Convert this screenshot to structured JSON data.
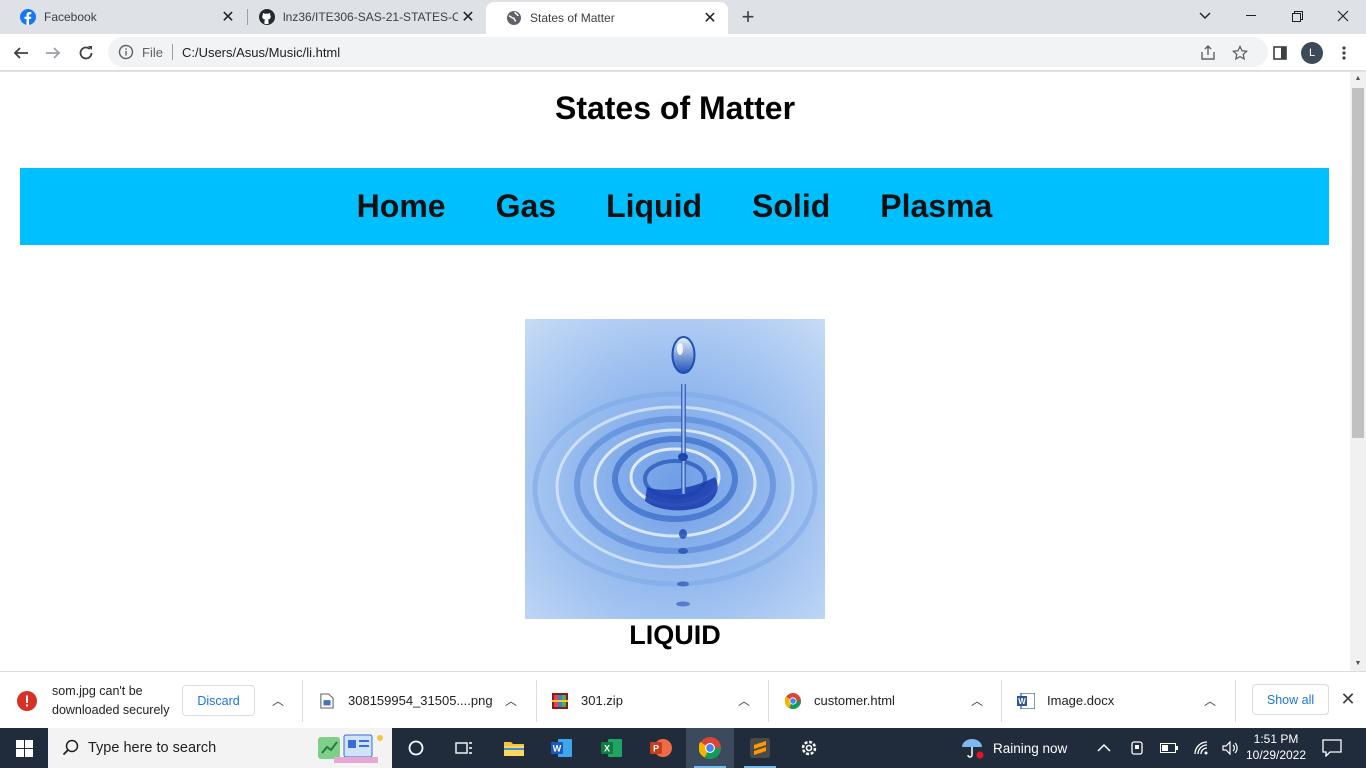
{
  "browser": {
    "tabs": [
      {
        "title": "Facebook",
        "favicon": "facebook-icon",
        "active": false
      },
      {
        "title": "lnz36/ITE306-SAS-21-STATES-OF",
        "favicon": "github-icon",
        "active": false
      },
      {
        "title": "States of Matter",
        "favicon": "globe-icon",
        "active": true
      }
    ],
    "address": {
      "scheme_label": "File",
      "url": "C:/Users/Asus/Music/li.html"
    },
    "profile_initial": "L"
  },
  "page": {
    "title": "States of Matter",
    "nav": [
      "Home",
      "Gas",
      "Liquid",
      "Solid",
      "Plasma"
    ],
    "image_alt": "water-drop-splash",
    "caption": "LIQUID",
    "colors": {
      "nav_bg": "#00bfff",
      "text": "#000000"
    }
  },
  "downloads": {
    "warning": {
      "line1": "som.jpg can't be",
      "line2": "downloaded securely",
      "discard_label": "Discard"
    },
    "items": [
      {
        "name": "308159954_31505....png",
        "icon": "image-file-icon"
      },
      {
        "name": "301.zip",
        "icon": "zip-archive-icon"
      },
      {
        "name": "customer.html",
        "icon": "chrome-html-icon"
      },
      {
        "name": "Image.docx",
        "icon": "word-doc-icon"
      }
    ],
    "show_all_label": "Show all"
  },
  "taskbar": {
    "search_placeholder": "Type here to search",
    "weather": "Raining now",
    "time": "1:51 PM",
    "date": "10/29/2022"
  }
}
